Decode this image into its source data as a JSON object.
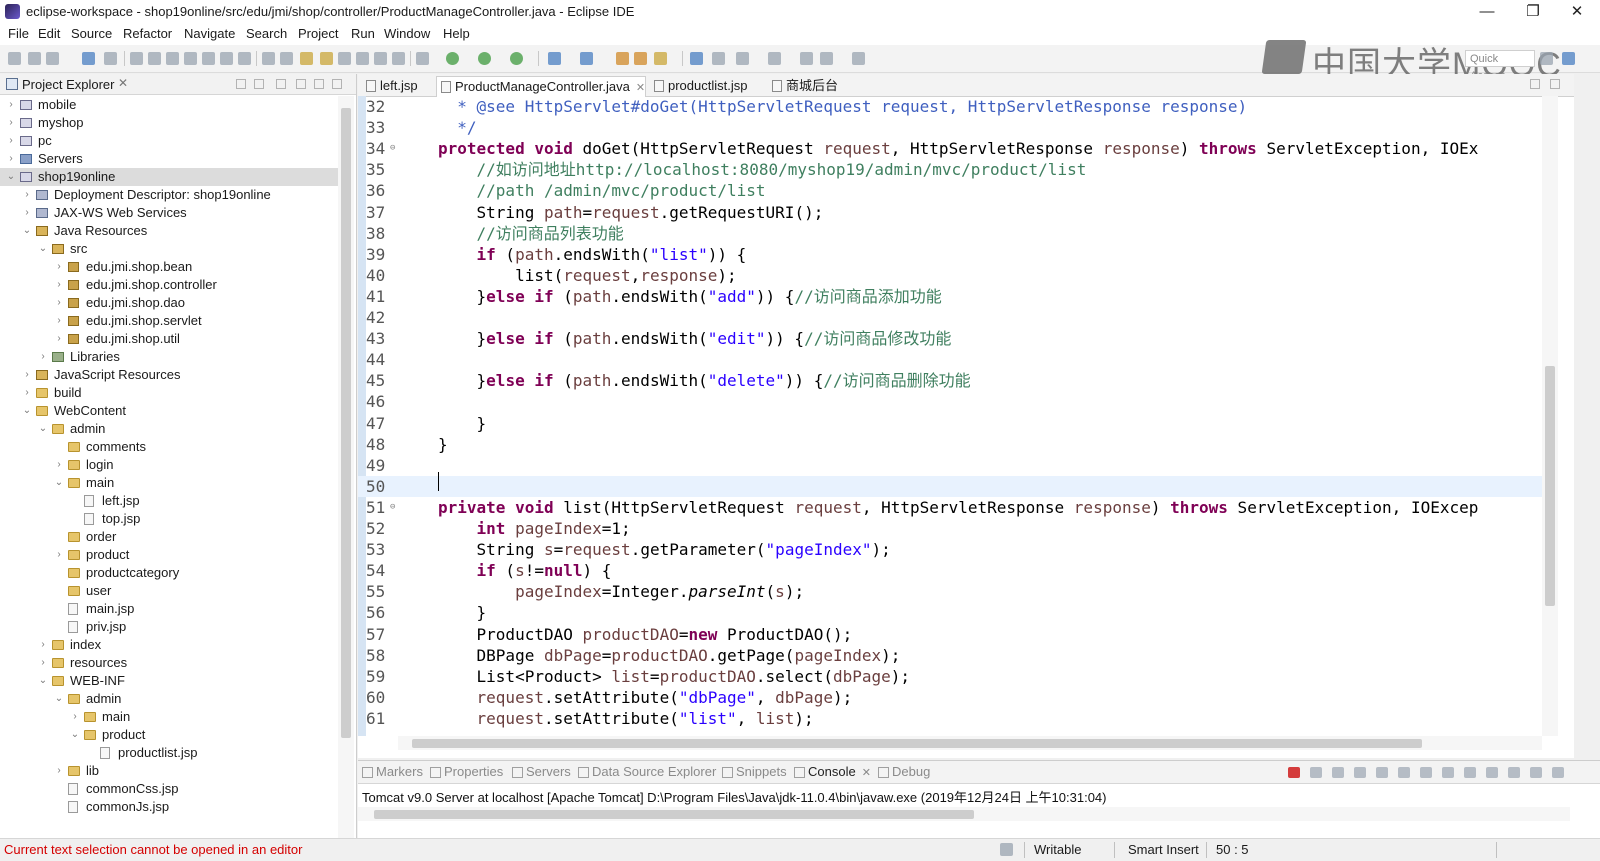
{
  "window": {
    "title": "eclipse-workspace - shop19online/src/edu/jmi/shop/controller/ProductManageController.java - Eclipse IDE",
    "minimize": "—",
    "restore": "❐",
    "close": "✕"
  },
  "menu": [
    "File",
    "Edit",
    "Source",
    "Refactor",
    "Navigate",
    "Search",
    "Project",
    "Run",
    "Window",
    "Help"
  ],
  "watermark": "中国大学MOOC",
  "quick_access": "Quick Access",
  "explorer": {
    "title": "Project Explorer",
    "items": [
      {
        "label": "mobile",
        "depth": 0,
        "arrow": "›",
        "icon": "project"
      },
      {
        "label": "myshop",
        "depth": 0,
        "arrow": "›",
        "icon": "project"
      },
      {
        "label": "pc",
        "depth": 0,
        "arrow": "›",
        "icon": "project"
      },
      {
        "label": "Servers",
        "depth": 0,
        "arrow": "›",
        "icon": "srv"
      },
      {
        "label": "shop19online",
        "depth": 0,
        "arrow": "⌄",
        "icon": "project",
        "selected": true
      },
      {
        "label": "Deployment Descriptor: shop19online",
        "depth": 1,
        "arrow": "›",
        "icon": "dd"
      },
      {
        "label": "JAX-WS Web Services",
        "depth": 1,
        "arrow": "›",
        "icon": "dd"
      },
      {
        "label": "Java Resources",
        "depth": 1,
        "arrow": "⌄",
        "icon": "srcf"
      },
      {
        "label": "src",
        "depth": 2,
        "arrow": "⌄",
        "icon": "srcf"
      },
      {
        "label": "edu.jmi.shop.bean",
        "depth": 3,
        "arrow": "›",
        "icon": "pkg"
      },
      {
        "label": "edu.jmi.shop.controller",
        "depth": 3,
        "arrow": "›",
        "icon": "pkg"
      },
      {
        "label": "edu.jmi.shop.dao",
        "depth": 3,
        "arrow": "›",
        "icon": "pkg"
      },
      {
        "label": "edu.jmi.shop.servlet",
        "depth": 3,
        "arrow": "›",
        "icon": "pkg"
      },
      {
        "label": "edu.jmi.shop.util",
        "depth": 3,
        "arrow": "›",
        "icon": "pkg"
      },
      {
        "label": "Libraries",
        "depth": 2,
        "arrow": "›",
        "icon": "lib"
      },
      {
        "label": "JavaScript Resources",
        "depth": 1,
        "arrow": "›",
        "icon": "srcf"
      },
      {
        "label": "build",
        "depth": 1,
        "arrow": "›",
        "icon": "folder"
      },
      {
        "label": "WebContent",
        "depth": 1,
        "arrow": "⌄",
        "icon": "folder"
      },
      {
        "label": "admin",
        "depth": 2,
        "arrow": "⌄",
        "icon": "folder"
      },
      {
        "label": "comments",
        "depth": 3,
        "arrow": "",
        "icon": "folder"
      },
      {
        "label": "login",
        "depth": 3,
        "arrow": "›",
        "icon": "folder"
      },
      {
        "label": "main",
        "depth": 3,
        "arrow": "⌄",
        "icon": "folder"
      },
      {
        "label": "left.jsp",
        "depth": 4,
        "arrow": "",
        "icon": "file"
      },
      {
        "label": "top.jsp",
        "depth": 4,
        "arrow": "",
        "icon": "file"
      },
      {
        "label": "order",
        "depth": 3,
        "arrow": "",
        "icon": "folder"
      },
      {
        "label": "product",
        "depth": 3,
        "arrow": "›",
        "icon": "folder"
      },
      {
        "label": "productcategory",
        "depth": 3,
        "arrow": "",
        "icon": "folder"
      },
      {
        "label": "user",
        "depth": 3,
        "arrow": "",
        "icon": "folder"
      },
      {
        "label": "main.jsp",
        "depth": 3,
        "arrow": "",
        "icon": "file"
      },
      {
        "label": "priv.jsp",
        "depth": 3,
        "arrow": "",
        "icon": "file"
      },
      {
        "label": "index",
        "depth": 2,
        "arrow": "›",
        "icon": "folder"
      },
      {
        "label": "resources",
        "depth": 2,
        "arrow": "›",
        "icon": "folder"
      },
      {
        "label": "WEB-INF",
        "depth": 2,
        "arrow": "⌄",
        "icon": "folder"
      },
      {
        "label": "admin",
        "depth": 3,
        "arrow": "⌄",
        "icon": "folder"
      },
      {
        "label": "main",
        "depth": 4,
        "arrow": "›",
        "icon": "folder"
      },
      {
        "label": "product",
        "depth": 4,
        "arrow": "⌄",
        "icon": "folder"
      },
      {
        "label": "productlist.jsp",
        "depth": 5,
        "arrow": "",
        "icon": "file"
      },
      {
        "label": "lib",
        "depth": 3,
        "arrow": "›",
        "icon": "folder"
      },
      {
        "label": "commonCss.jsp",
        "depth": 3,
        "arrow": "",
        "icon": "file"
      },
      {
        "label": "commonJs.jsp",
        "depth": 3,
        "arrow": "",
        "icon": "file"
      }
    ]
  },
  "editor_tabs": [
    {
      "label": "left.jsp",
      "active": false,
      "close": ""
    },
    {
      "label": "ProductManageController.java",
      "active": true,
      "close": "✕"
    },
    {
      "label": "productlist.jsp",
      "active": false,
      "close": ""
    },
    {
      "label": "商城后台",
      "active": false,
      "close": ""
    }
  ],
  "code_lines": [
    {
      "n": "32",
      "fold": "",
      "html": "<span class=\"jd\">  * @see HttpServlet#doGet(HttpServletRequest request, HttpServletResponse response)</span>"
    },
    {
      "n": "33",
      "fold": "",
      "html": "<span class=\"jd\">  */</span>"
    },
    {
      "n": "34",
      "fold": "⊖",
      "html": "<span class=\"kw\">protected</span> <span class=\"kw\">void</span> doGet(HttpServletRequest <span class=\"par\">request</span>, HttpServletResponse <span class=\"par\">response</span>) <span class=\"kw\">throws</span> ServletException, IOEx"
    },
    {
      "n": "35",
      "fold": "",
      "html": "    <span class=\"cmt\">//如访问地址http://localhost:8080/myshop19/admin/mvc/product/list</span>"
    },
    {
      "n": "36",
      "fold": "",
      "html": "    <span class=\"cmt\">//path /admin/mvc/product/list</span>"
    },
    {
      "n": "37",
      "fold": "",
      "html": "    String <span class=\"par\">path</span>=<span class=\"par\">request</span>.getRequestURI();"
    },
    {
      "n": "38",
      "fold": "",
      "html": "    <span class=\"cmt\">//访问商品列表功能</span>"
    },
    {
      "n": "39",
      "fold": "",
      "html": "    <span class=\"kw\">if</span> (<span class=\"par\">path</span>.endsWith(<span class=\"str\">\"list\"</span>)) {"
    },
    {
      "n": "40",
      "fold": "",
      "html": "        list(<span class=\"par\">request</span>,<span class=\"par\">response</span>);"
    },
    {
      "n": "41",
      "fold": "",
      "html": "    }<span class=\"kw\">else</span> <span class=\"kw\">if</span> (<span class=\"par\">path</span>.endsWith(<span class=\"str\">\"add\"</span>)) {<span class=\"cmt\">//访问商品添加功能</span>"
    },
    {
      "n": "42",
      "fold": "",
      "html": ""
    },
    {
      "n": "43",
      "fold": "",
      "html": "    }<span class=\"kw\">else</span> <span class=\"kw\">if</span> (<span class=\"par\">path</span>.endsWith(<span class=\"str\">\"edit\"</span>)) {<span class=\"cmt\">//访问商品修改功能</span>"
    },
    {
      "n": "44",
      "fold": "",
      "html": ""
    },
    {
      "n": "45",
      "fold": "",
      "html": "    }<span class=\"kw\">else</span> <span class=\"kw\">if</span> (<span class=\"par\">path</span>.endsWith(<span class=\"str\">\"delete\"</span>)) {<span class=\"cmt\">//访问商品删除功能</span>"
    },
    {
      "n": "46",
      "fold": "",
      "html": ""
    },
    {
      "n": "47",
      "fold": "",
      "html": "    }"
    },
    {
      "n": "48",
      "fold": "",
      "html": "}"
    },
    {
      "n": "49",
      "fold": "",
      "html": ""
    },
    {
      "n": "50",
      "fold": "",
      "html": "",
      "current": true
    },
    {
      "n": "51",
      "fold": "⊖",
      "html": "<span class=\"kw\">private</span> <span class=\"kw\">void</span> list(HttpServletRequest <span class=\"par\">request</span>, HttpServletResponse <span class=\"par\">response</span>) <span class=\"kw\">throws</span> ServletException, IOExcep"
    },
    {
      "n": "52",
      "fold": "",
      "html": "    <span class=\"kw\">int</span> <span class=\"par\">pageIndex</span>=1;"
    },
    {
      "n": "53",
      "fold": "",
      "html": "    String <span class=\"par\">s</span>=<span class=\"par\">request</span>.getParameter(<span class=\"str\">\"pageIndex\"</span>);"
    },
    {
      "n": "54",
      "fold": "",
      "html": "    <span class=\"kw\">if</span> (<span class=\"par\">s</span>!=<span class=\"kw\">null</span>) {"
    },
    {
      "n": "55",
      "fold": "",
      "html": "        <span class=\"par\">pageIndex</span>=Integer.<span class=\"it\">parseInt</span>(<span class=\"par\">s</span>);"
    },
    {
      "n": "56",
      "fold": "",
      "html": "    }"
    },
    {
      "n": "57",
      "fold": "",
      "html": "    ProductDAO <span class=\"par\">productDAO</span>=<span class=\"kw\">new</span> ProductDAO();"
    },
    {
      "n": "58",
      "fold": "",
      "html": "    DBPage <span class=\"par\">dbPage</span>=<span class=\"par\">productDAO</span>.getPage(<span class=\"par\">pageIndex</span>);"
    },
    {
      "n": "59",
      "fold": "",
      "html": "    List&lt;Product&gt; <span class=\"par\">list</span>=<span class=\"par\">productDAO</span>.select(<span class=\"par\">dbPage</span>);"
    },
    {
      "n": "60",
      "fold": "",
      "html": "    <span class=\"par\">request</span>.setAttribute(<span class=\"str\">\"dbPage\"</span>, <span class=\"par\">dbPage</span>);"
    },
    {
      "n": "61",
      "fold": "",
      "html": "    <span class=\"par\">request</span>.setAttribute(<span class=\"str\">\"list\"</span>, <span class=\"par\">list</span>);"
    }
  ],
  "bottom_tabs": [
    {
      "label": "Markers",
      "active": false
    },
    {
      "label": "Properties",
      "active": false
    },
    {
      "label": "Servers",
      "active": false
    },
    {
      "label": "Data Source Explorer",
      "active": false
    },
    {
      "label": "Snippets",
      "active": false
    },
    {
      "label": "Console",
      "active": true
    },
    {
      "label": "Debug",
      "active": false
    }
  ],
  "console_text": "Tomcat v9.0 Server at localhost [Apache Tomcat] D:\\Program Files\\Java\\jdk-11.0.4\\bin\\javaw.exe (2019年12月24日 上午10:31:04)",
  "status": {
    "message": "Current text selection cannot be opened in an editor",
    "writable": "Writable",
    "insert_mode": "Smart Insert",
    "position": "50 : 5"
  },
  "colors": {
    "keyword": "#7f0055",
    "string": "#2a00ff",
    "comment": "#3f7f5f",
    "javadoc": "#3f5fbf",
    "status_error": "#d40000"
  }
}
